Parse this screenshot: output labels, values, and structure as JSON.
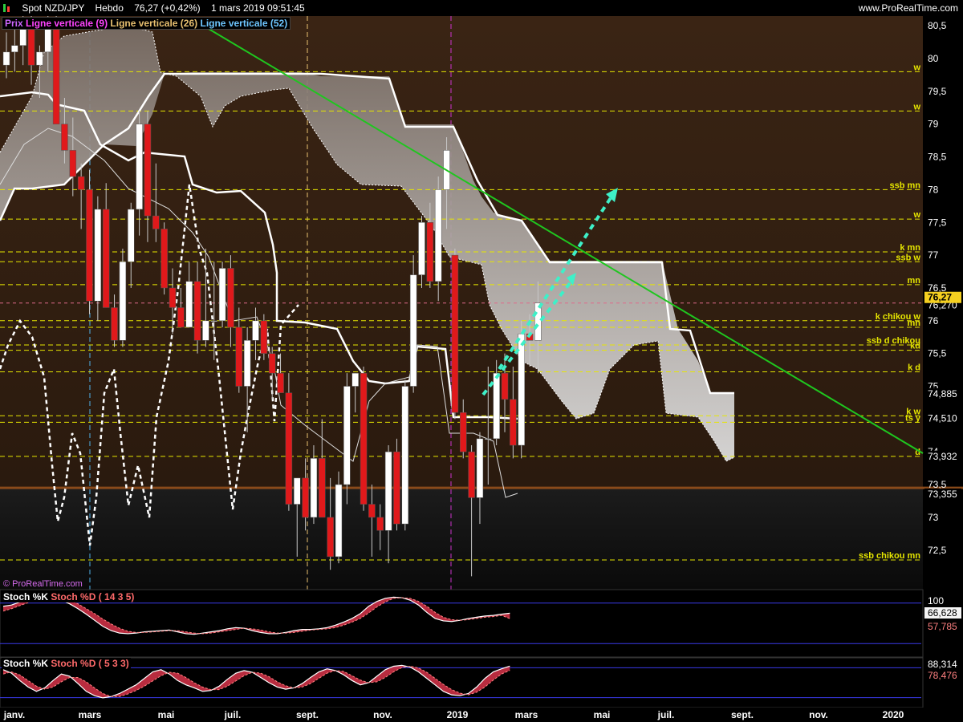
{
  "header": {
    "symbol": "Spot NZD/JPY",
    "period": "Hebdo",
    "quote": "76,27 (+0,42%)",
    "datetime": "1 mars 2019 09:51:45",
    "site": "www.ProRealTime.com"
  },
  "legend": {
    "prix": "Prix",
    "v9": "Ligne verticale (9)",
    "v26": "Ligne verticale (26)",
    "v52": "Ligne verticale (52)"
  },
  "watermark": "© ProRealTime.com",
  "colors": {
    "bull": "#ffffff",
    "bear": "#e0191b",
    "trend": "#1fc61f",
    "arrow": "#3ef0c8",
    "level": "#e6e600",
    "support": "#8a4a1a",
    "v9": "#cc33cc",
    "v26": "#e8c070",
    "v52": "#4fb0e8"
  },
  "chart_data": {
    "type": "candlestick",
    "x_axis_labels": [
      "janv.",
      "mars",
      "mai",
      "juil.",
      "sept.",
      "nov.",
      "2019",
      "mars",
      "mai",
      "juil.",
      "sept.",
      "nov.",
      "2020"
    ],
    "y_ticks": [
      "80,5",
      "80",
      "79,5",
      "79",
      "78,5",
      "78",
      "77,5",
      "77",
      "76,5",
      "76",
      "75,5",
      "75",
      "74,5",
      "74",
      "73,5",
      "73",
      "72,5"
    ],
    "ylim": [
      72.0,
      80.7
    ],
    "current_price": "76,27",
    "price_labels": [
      "76,270",
      "74,885",
      "74,510",
      "73,932",
      "73,355"
    ],
    "candles": [
      {
        "o": 79.9,
        "h": 80.4,
        "l": 79.7,
        "c": 80.1
      },
      {
        "o": 80.1,
        "h": 80.6,
        "l": 79.8,
        "c": 80.2
      },
      {
        "o": 80.2,
        "h": 80.7,
        "l": 79.9,
        "c": 80.5
      },
      {
        "o": 80.5,
        "h": 80.7,
        "l": 79.6,
        "c": 79.9
      },
      {
        "o": 79.9,
        "h": 80.2,
        "l": 79.4,
        "c": 80.1
      },
      {
        "o": 80.1,
        "h": 80.7,
        "l": 79.8,
        "c": 80.6
      },
      {
        "o": 80.6,
        "h": 80.7,
        "l": 79.0,
        "c": 79.0
      },
      {
        "o": 79.0,
        "h": 79.4,
        "l": 78.4,
        "c": 78.6
      },
      {
        "o": 78.6,
        "h": 79.1,
        "l": 77.9,
        "c": 78.2
      },
      {
        "o": 78.2,
        "h": 78.4,
        "l": 77.4,
        "c": 78.0
      },
      {
        "o": 78.0,
        "h": 78.3,
        "l": 76.1,
        "c": 76.3
      },
      {
        "o": 76.3,
        "h": 77.9,
        "l": 76.0,
        "c": 77.7
      },
      {
        "o": 77.7,
        "h": 78.1,
        "l": 76.2,
        "c": 76.2
      },
      {
        "o": 76.2,
        "h": 76.4,
        "l": 75.6,
        "c": 75.7
      },
      {
        "o": 75.7,
        "h": 77.1,
        "l": 75.6,
        "c": 76.9
      },
      {
        "o": 76.9,
        "h": 77.8,
        "l": 76.5,
        "c": 77.7
      },
      {
        "o": 77.7,
        "h": 79.2,
        "l": 77.3,
        "c": 79.0
      },
      {
        "o": 79.0,
        "h": 79.2,
        "l": 77.2,
        "c": 77.6
      },
      {
        "o": 77.6,
        "h": 78.4,
        "l": 77.2,
        "c": 77.4
      },
      {
        "o": 77.4,
        "h": 77.5,
        "l": 76.4,
        "c": 76.5
      },
      {
        "o": 76.5,
        "h": 76.8,
        "l": 75.8,
        "c": 76.2
      },
      {
        "o": 76.2,
        "h": 76.5,
        "l": 75.9,
        "c": 75.9
      },
      {
        "o": 75.9,
        "h": 76.9,
        "l": 75.9,
        "c": 76.6
      },
      {
        "o": 76.6,
        "h": 76.9,
        "l": 75.5,
        "c": 75.7
      },
      {
        "o": 75.7,
        "h": 77.1,
        "l": 75.6,
        "c": 76.0
      },
      {
        "o": 76.0,
        "h": 76.9,
        "l": 75.4,
        "c": 76.0
      },
      {
        "o": 76.0,
        "h": 76.9,
        "l": 75.9,
        "c": 76.8
      },
      {
        "o": 76.8,
        "h": 77.0,
        "l": 75.6,
        "c": 75.9
      },
      {
        "o": 75.9,
        "h": 76.2,
        "l": 74.9,
        "c": 75.0
      },
      {
        "o": 75.0,
        "h": 75.9,
        "l": 74.3,
        "c": 75.7
      },
      {
        "o": 75.7,
        "h": 76.2,
        "l": 75.4,
        "c": 76.0
      },
      {
        "o": 76.0,
        "h": 76.1,
        "l": 75.4,
        "c": 75.5
      },
      {
        "o": 75.5,
        "h": 75.6,
        "l": 74.8,
        "c": 75.2
      },
      {
        "o": 75.2,
        "h": 75.5,
        "l": 74.9,
        "c": 74.9
      },
      {
        "o": 74.9,
        "h": 75.2,
        "l": 73.1,
        "c": 73.2
      },
      {
        "o": 73.2,
        "h": 73.5,
        "l": 72.4,
        "c": 73.6
      },
      {
        "o": 73.6,
        "h": 73.9,
        "l": 72.8,
        "c": 73.0
      },
      {
        "o": 73.0,
        "h": 74.1,
        "l": 72.9,
        "c": 73.9
      },
      {
        "o": 73.9,
        "h": 74.5,
        "l": 73.4,
        "c": 73.0
      },
      {
        "o": 73.0,
        "h": 73.6,
        "l": 72.2,
        "c": 72.4
      },
      {
        "o": 72.4,
        "h": 73.7,
        "l": 72.3,
        "c": 73.5
      },
      {
        "o": 73.5,
        "h": 75.2,
        "l": 73.2,
        "c": 75.0
      },
      {
        "o": 75.0,
        "h": 75.2,
        "l": 74.6,
        "c": 75.2
      },
      {
        "o": 75.2,
        "h": 75.3,
        "l": 73.1,
        "c": 73.2
      },
      {
        "o": 73.2,
        "h": 73.5,
        "l": 72.4,
        "c": 73.0
      },
      {
        "o": 73.0,
        "h": 73.2,
        "l": 72.5,
        "c": 72.8
      },
      {
        "o": 72.8,
        "h": 74.1,
        "l": 72.3,
        "c": 74.0
      },
      {
        "o": 74.0,
        "h": 74.2,
        "l": 72.8,
        "c": 72.9
      },
      {
        "o": 72.9,
        "h": 75.1,
        "l": 72.8,
        "c": 75.0
      },
      {
        "o": 75.0,
        "h": 77.0,
        "l": 74.9,
        "c": 76.7
      },
      {
        "o": 76.7,
        "h": 77.6,
        "l": 76.5,
        "c": 77.5
      },
      {
        "o": 77.5,
        "h": 77.8,
        "l": 76.5,
        "c": 76.6
      },
      {
        "o": 76.6,
        "h": 78.2,
        "l": 76.3,
        "c": 78.0
      },
      {
        "o": 78.0,
        "h": 78.8,
        "l": 77.4,
        "c": 78.6
      },
      {
        "o": 77.0,
        "h": 77.1,
        "l": 74.5,
        "c": 74.6
      },
      {
        "o": 74.6,
        "h": 74.8,
        "l": 73.9,
        "c": 74.0
      },
      {
        "o": 74.0,
        "h": 74.1,
        "l": 72.1,
        "c": 73.3
      },
      {
        "o": 73.3,
        "h": 74.3,
        "l": 72.9,
        "c": 74.2
      },
      {
        "o": 74.2,
        "h": 75.3,
        "l": 73.5,
        "c": 74.2
      },
      {
        "o": 74.2,
        "h": 75.4,
        "l": 74.1,
        "c": 75.2
      },
      {
        "o": 75.2,
        "h": 75.5,
        "l": 74.3,
        "c": 74.8
      },
      {
        "o": 74.8,
        "h": 75.3,
        "l": 73.9,
        "c": 74.1
      },
      {
        "o": 74.1,
        "h": 76.0,
        "l": 73.9,
        "c": 75.8
      },
      {
        "o": 75.8,
        "h": 76.1,
        "l": 75.3,
        "c": 75.7
      },
      {
        "o": 75.7,
        "h": 76.6,
        "l": 75.2,
        "c": 76.27
      }
    ],
    "horizontal_levels": [
      {
        "label": "w",
        "y": 79.8
      },
      {
        "label": "w",
        "y": 79.2
      },
      {
        "label": "ssb mn",
        "y": 78.0
      },
      {
        "label": "w",
        "y": 77.55
      },
      {
        "label": "k mn",
        "y": 77.05
      },
      {
        "label": "ssb w",
        "y": 76.9
      },
      {
        "label": "mn",
        "y": 76.55
      },
      {
        "label": "k chikou w",
        "y": 76.0
      },
      {
        "label": "mn",
        "y": 75.9
      },
      {
        "label": "ssb d chikou",
        "y": 75.63
      },
      {
        "label": "kd",
        "y": 75.55
      },
      {
        "label": "k d",
        "y": 75.22
      },
      {
        "label": "k w",
        "y": 74.55
      },
      {
        "label": "ts y",
        "y": 74.45
      },
      {
        "label": "d",
        "y": 73.93
      },
      {
        "label": "ssb chikou mn",
        "y": 72.35
      }
    ],
    "support_line": 73.45
  },
  "stoch1": {
    "label_k": "Stoch %K",
    "label_d": "Stoch %D ( 14 3 5)",
    "axis_top": "100",
    "value_k": "66,628",
    "value_d": "57,785",
    "k": [
      78,
      80,
      85,
      90,
      93,
      93,
      91,
      88,
      82,
      74,
      65,
      55,
      45,
      38,
      34,
      33,
      34,
      36,
      37,
      38,
      39,
      36,
      33,
      32,
      34,
      36,
      38,
      41,
      43,
      42,
      38,
      35,
      33,
      33,
      35,
      38,
      40,
      40,
      41,
      43,
      47,
      52,
      58,
      66,
      78,
      86,
      91,
      93,
      92,
      88,
      80,
      68,
      58,
      54,
      53,
      55,
      58,
      60,
      62,
      63,
      65,
      66.6
    ],
    "d": [
      70,
      74,
      79,
      84,
      88,
      91,
      92,
      91,
      88,
      82,
      74,
      66,
      57,
      49,
      42,
      37,
      35,
      35,
      36,
      37,
      38,
      38,
      36,
      34,
      33,
      34,
      36,
      38,
      40,
      42,
      41,
      39,
      36,
      34,
      34,
      35,
      37,
      39,
      40,
      41,
      43,
      47,
      52,
      58,
      67,
      77,
      85,
      91,
      92,
      91,
      86,
      78,
      68,
      60,
      56,
      55,
      56,
      58,
      60,
      61,
      63,
      57.8
    ]
  },
  "stoch2": {
    "label_k": "Stoch %K",
    "label_d": "Stoch %D ( 5 3 3)",
    "axis_top": "88,314",
    "value_d": "78,476",
    "k": [
      80,
      72,
      55,
      40,
      30,
      38,
      55,
      70,
      65,
      48,
      30,
      20,
      15,
      18,
      25,
      35,
      45,
      60,
      75,
      80,
      70,
      55,
      45,
      38,
      30,
      32,
      42,
      58,
      72,
      78,
      74,
      62,
      50,
      40,
      35,
      38,
      48,
      62,
      75,
      82,
      78,
      68,
      55,
      45,
      50,
      65,
      80,
      88,
      90,
      86,
      75,
      60,
      45,
      30,
      22,
      20,
      25,
      40,
      60,
      75,
      82,
      88.3
    ],
    "d": [
      70,
      75,
      68,
      55,
      42,
      35,
      40,
      52,
      62,
      62,
      52,
      38,
      25,
      18,
      18,
      24,
      32,
      42,
      54,
      66,
      74,
      72,
      62,
      50,
      40,
      34,
      34,
      42,
      54,
      66,
      74,
      72,
      64,
      52,
      43,
      38,
      40,
      48,
      60,
      72,
      78,
      76,
      66,
      56,
      50,
      52,
      62,
      75,
      85,
      88,
      84,
      74,
      60,
      46,
      34,
      26,
      22,
      28,
      40,
      56,
      70,
      78.5
    ]
  }
}
